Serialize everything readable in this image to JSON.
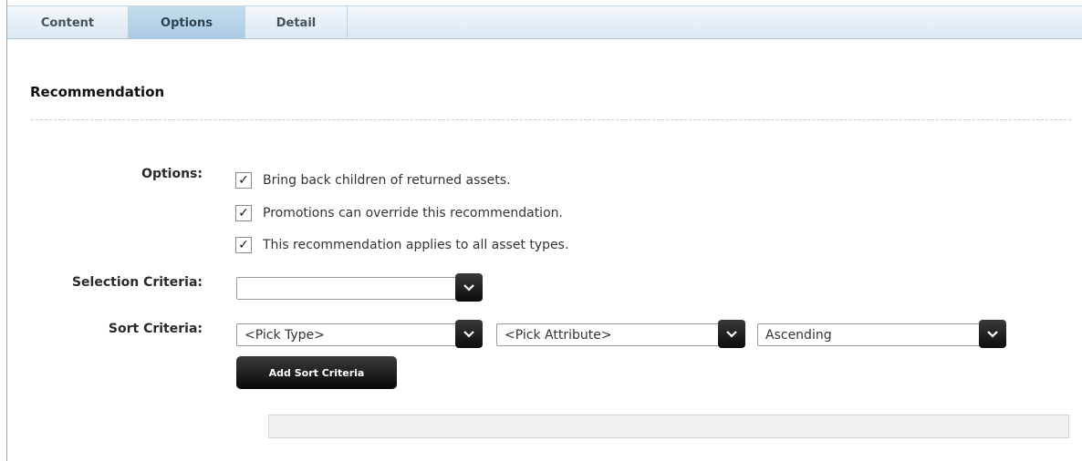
{
  "tabs": [
    {
      "label": "Content",
      "active": false
    },
    {
      "label": "Options",
      "active": true
    },
    {
      "label": "Detail",
      "active": false
    }
  ],
  "section_title": "Recommendation",
  "options": {
    "label": "Options:",
    "items": [
      {
        "label": "Bring back children of returned assets.",
        "checked": true,
        "mark": "✓"
      },
      {
        "label": "Promotions can override this recommendation.",
        "checked": true,
        "mark": "✓"
      },
      {
        "label": "This recommendation applies to all asset types.",
        "checked": true,
        "mark": "✓"
      }
    ]
  },
  "selection_criteria": {
    "label": "Selection Criteria:",
    "value": ""
  },
  "sort_criteria": {
    "label": "Sort Criteria:",
    "type_value": "<Pick Type>",
    "attribute_value": "<Pick Attribute>",
    "order_value": "Ascending",
    "add_button": "Add Sort Criteria"
  },
  "colors": {
    "tab_active": "#a9cbe2",
    "tab_bar": "#dbe8f2",
    "button": "#080808"
  }
}
